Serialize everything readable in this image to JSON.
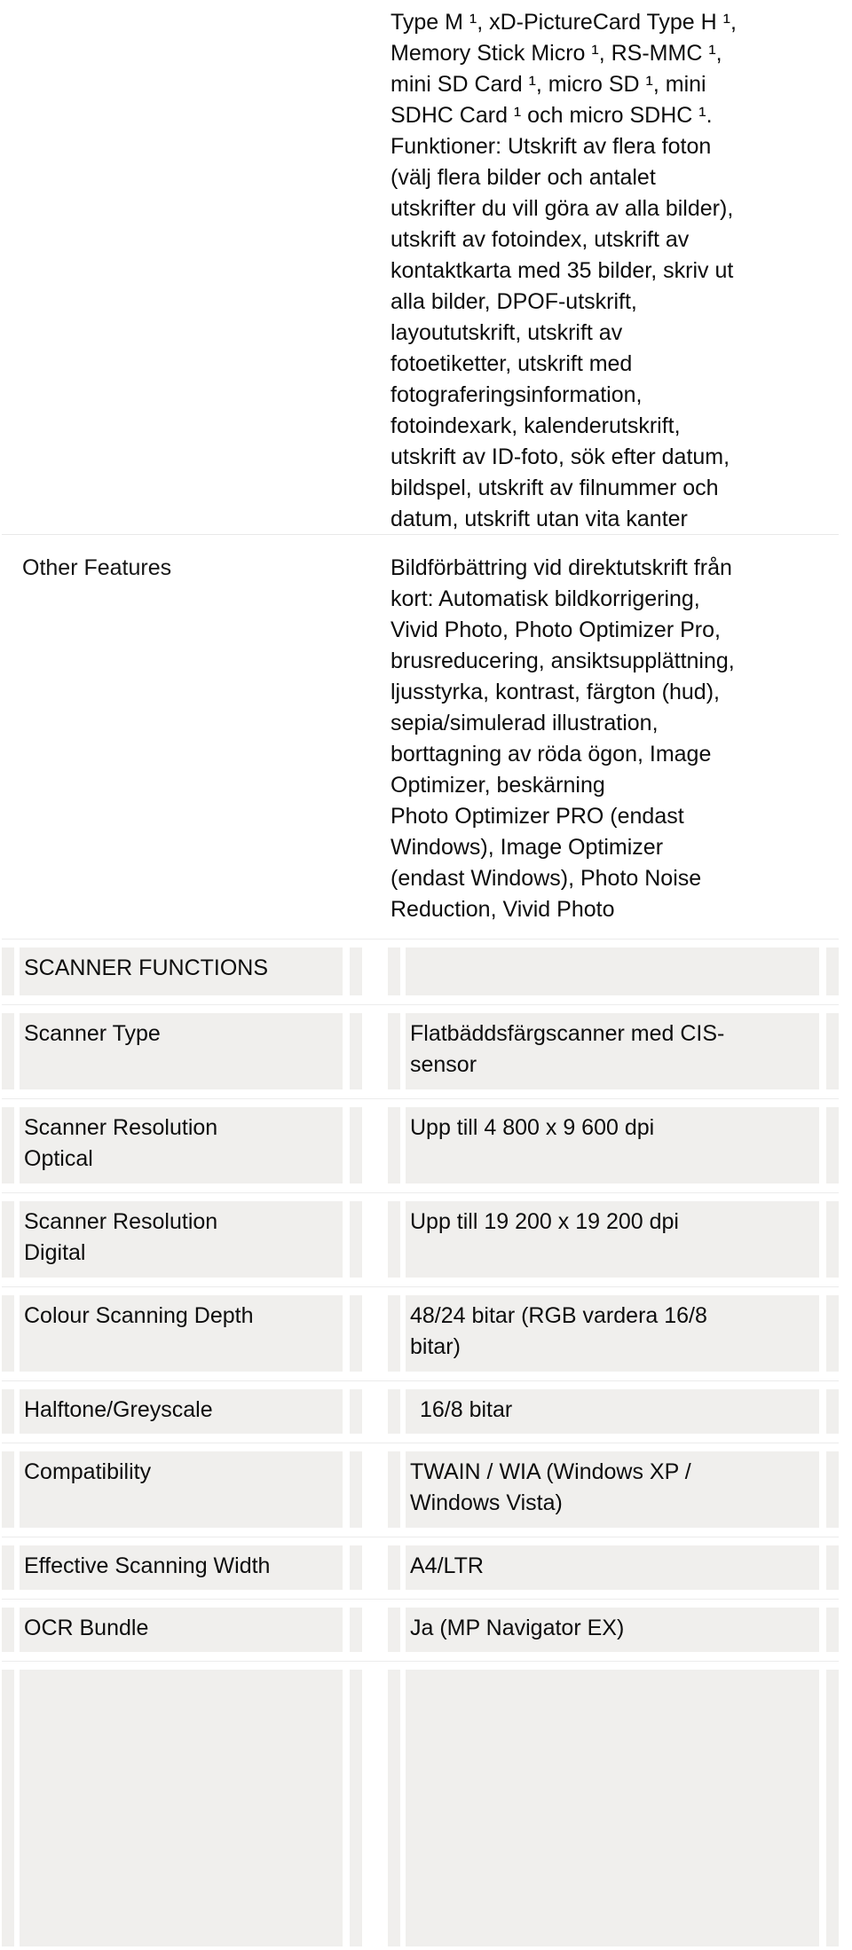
{
  "document": {
    "type": "product-specification-sheet",
    "language": "sv"
  },
  "continuation": {
    "memory_card_value": "Type M ¹, xD-PictureCard Type H ¹,\nMemory Stick Micro ¹, RS-MMC ¹,\nmini SD Card ¹, micro SD ¹, mini\nSDHC Card ¹ och micro SDHC ¹.\nFunktioner: Utskrift av flera foton\n(välj flera bilder och antalet\nutskrifter du vill göra av alla bilder),\nutskrift av fotoindex, utskrift av\nkontaktkarta med 35 bilder, skriv ut\nalla bilder, DPOF-utskrift,\nlayoututskrift, utskrift av\nfotoetiketter, utskrift med\nfotograferingsinformation,\nfotoindexark, kalenderutskrift,\nutskrift av ID-foto, sök efter datum,\nbildspel, utskrift av filnummer och\ndatum, utskrift utan vita kanter",
    "other_features_label": "Other Features",
    "other_features_value": "Bildförbättring vid direktutskrift från\nkort: Automatisk bildkorrigering,\nVivid Photo, Photo Optimizer Pro,\nbrusreducering, ansiktsupplättning,\nljusstyrka, kontrast, färgton (hud),\nsepia/simulerad illustration,\nborttagning av röda ögon, Image\nOptimizer, beskärning\nPhoto Optimizer PRO (endast\nWindows), Image Optimizer\n(endast Windows), Photo Noise\nReduction, Vivid Photo"
  },
  "scanner_table": {
    "section_heading": "SCANNER FUNCTIONS",
    "section_heading_value": "",
    "rows": [
      {
        "label": "Scanner Type",
        "value": "Flatbäddsfärgscanner med CIS-\nsensor"
      },
      {
        "label": "Scanner Resolution\nOptical",
        "value": "Upp till 4 800 x 9 600 dpi"
      },
      {
        "label": "Scanner Resolution\nDigital",
        "value": "Upp till 19 200 x 19 200 dpi"
      },
      {
        "label": "Colour Scanning Depth",
        "value": "48/24 bitar (RGB vardera 16/8\nbitar)"
      },
      {
        "label": "Halftone/Greyscale",
        "value": "16/8 bitar"
      },
      {
        "label": "Compatibility",
        "value": "TWAIN / WIA (Windows XP /\nWindows Vista)"
      },
      {
        "label": "Effective Scanning Width",
        "value": "A4/LTR"
      },
      {
        "label": "OCR Bundle",
        "value": "Ja (MP Navigator EX)"
      },
      {
        "label": "",
        "value": ""
      }
    ]
  },
  "colors": {
    "page_background": "#ffffff",
    "cell_background": "#f0efed",
    "text": "#0d0d0d",
    "rule": "#ececec"
  }
}
